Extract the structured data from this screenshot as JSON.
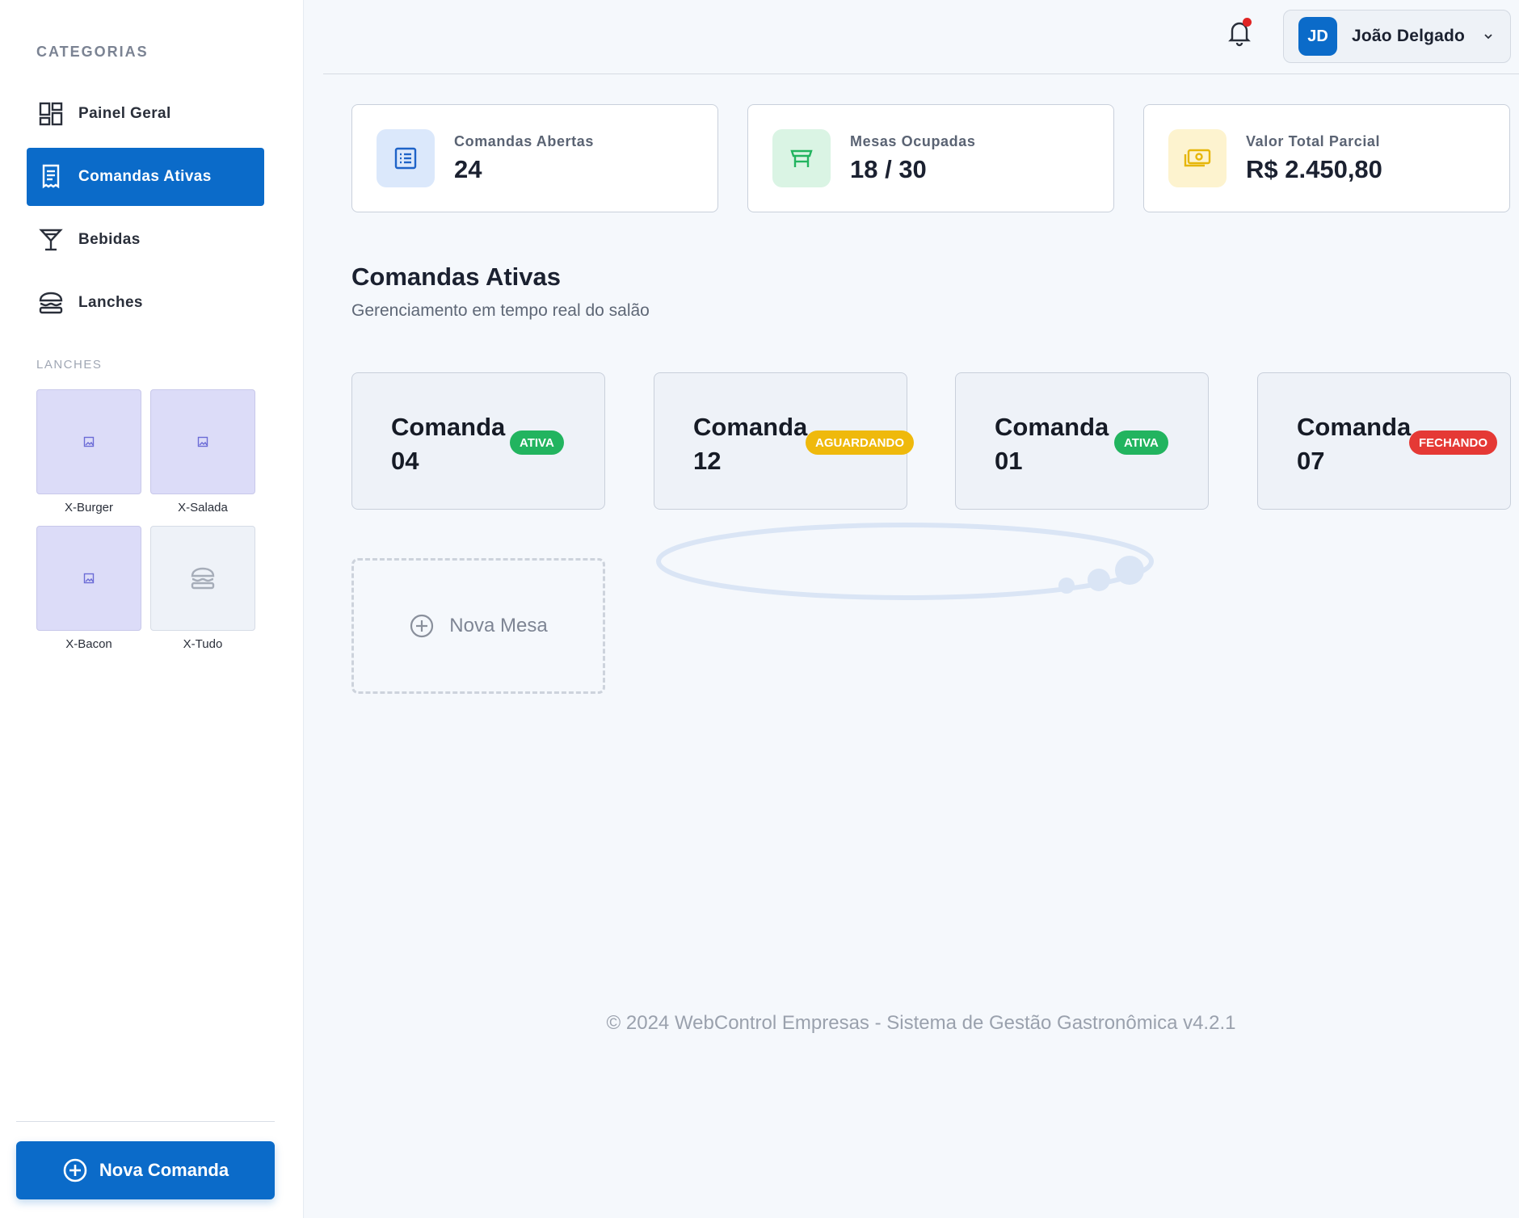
{
  "sidebar": {
    "section_title": "CATEGORIAS",
    "nav": [
      {
        "label": "Painel Geral",
        "icon": "dashboard-icon"
      },
      {
        "label": "Comandas Ativas",
        "icon": "receipt-icon",
        "active": true
      },
      {
        "label": "Bebidas",
        "icon": "cocktail-icon"
      },
      {
        "label": "Lanches",
        "icon": "burger-icon"
      }
    ],
    "sub_title": "LANCHES",
    "products": [
      {
        "name": "X-Burger",
        "icon": "image-placeholder-icon"
      },
      {
        "name": "X-Salada",
        "icon": "image-placeholder-icon"
      },
      {
        "name": "X-Bacon",
        "icon": "image-placeholder-icon"
      },
      {
        "name": "X-Tudo",
        "icon": "burger-icon"
      }
    ],
    "new_command_label": "Nova Comanda"
  },
  "header": {
    "user_initials": "JD",
    "user_name": "João Delgado",
    "notification_dot_color": "#e02424"
  },
  "stats": [
    {
      "label": "Comandas Abertas",
      "value": "24",
      "icon": "list-icon",
      "icon_bg": "#dbe8fb",
      "icon_color": "#1e63c8"
    },
    {
      "label": "Mesas Ocupadas",
      "value": "18 / 30",
      "icon": "table-icon",
      "icon_bg": "#daf4e4",
      "icon_color": "#22b45f"
    },
    {
      "label": "Valor Total Parcial",
      "value": "R$ 2.450,80",
      "icon": "money-icon",
      "icon_bg": "#fdf3cf",
      "icon_color": "#e6b60a"
    }
  ],
  "main": {
    "title": "Comandas Ativas",
    "subtitle": "Gerenciamento em tempo real do salão",
    "commands": [
      {
        "title": "Comanda",
        "number": "04",
        "status": "ATIVA",
        "status_color": "#22b45f"
      },
      {
        "title": "Comanda",
        "number": "12",
        "status": "AGUARDANDO",
        "status_color": "#efb90c"
      },
      {
        "title": "Comanda",
        "number": "01",
        "status": "ATIVA",
        "status_color": "#22b45f"
      },
      {
        "title": "Comanda",
        "number": "07",
        "status": "FECHANDO",
        "status_color": "#e53935"
      }
    ],
    "new_table_label": "Nova Mesa"
  },
  "footer": "© 2024 WebControl Empresas - Sistema de Gestão Gastronômica v4.2.1",
  "colors": {
    "accent": "#0b6bc9",
    "background": "#f5f8fc"
  }
}
